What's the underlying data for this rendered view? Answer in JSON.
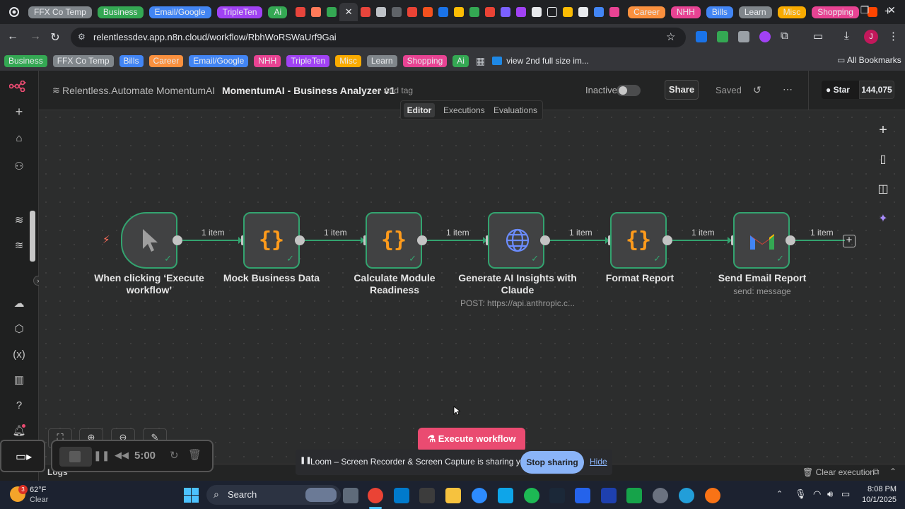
{
  "browser": {
    "tab_groups": [
      {
        "label": "FFX Co Temp",
        "color": "#80868b"
      },
      {
        "label": "Business",
        "color": "#34a853"
      },
      {
        "label": "Email/Google",
        "color": "#4285f4"
      },
      {
        "label": "TripleTen",
        "color": "#a142f4"
      },
      {
        "label": "Ai",
        "color": "#34a853"
      }
    ],
    "tab_groups_right": [
      {
        "label": "Career",
        "color": "#fa903e"
      },
      {
        "label": "NHH",
        "color": "#e84393"
      },
      {
        "label": "Bills",
        "color": "#4285f4"
      },
      {
        "label": "Learn",
        "color": "#80868b"
      },
      {
        "label": "Misc",
        "color": "#f9ab00"
      },
      {
        "label": "Shopping",
        "color": "#e84393"
      }
    ],
    "url": "relentlessdev.app.n8n.cloud/workflow/RbhWoRSWaUrf9Gai",
    "profile_initial": "J",
    "bookmarks": [
      {
        "label": "Business",
        "color": "#34a853"
      },
      {
        "label": "FFX Co Temp",
        "color": "#80868b"
      },
      {
        "label": "Bills",
        "color": "#4285f4"
      },
      {
        "label": "Career",
        "color": "#fa903e"
      },
      {
        "label": "Email/Google",
        "color": "#4285f4"
      },
      {
        "label": "NHH",
        "color": "#e84393"
      },
      {
        "label": "TripleTen",
        "color": "#a142f4"
      },
      {
        "label": "Misc",
        "color": "#f9ab00"
      },
      {
        "label": "Learn",
        "color": "#80868b"
      },
      {
        "label": "Shopping",
        "color": "#e84393"
      },
      {
        "label": "Ai",
        "color": "#34a853"
      }
    ],
    "bookmark_link": "view 2nd full size im...",
    "all_bookmarks": "All Bookmarks"
  },
  "n8n": {
    "breadcrumb": {
      "project": "Relentless.Automate",
      "folder": "MomentumAI",
      "workflow": "MomentumAI - Business Analyzer v1",
      "add_tag": "+ Add tag"
    },
    "status": {
      "label": "Inactive"
    },
    "share_label": "Share",
    "saved_label": "Saved",
    "github": {
      "star_label": "Star",
      "count": "144,075"
    },
    "tabs": [
      {
        "label": "Editor",
        "active": true
      },
      {
        "label": "Executions",
        "active": false
      },
      {
        "label": "Evaluations",
        "active": false
      }
    ],
    "nodes": [
      {
        "label": "When clicking ‘Execute workflow’",
        "subtitle": "",
        "icon": "cursor-icon"
      },
      {
        "label": "Mock Business Data",
        "subtitle": "",
        "icon": "code-icon"
      },
      {
        "label": "Calculate Module Readiness",
        "subtitle": "",
        "icon": "code-icon"
      },
      {
        "label": "Generate AI Insights with Claude",
        "subtitle": "POST: https://api.anthropic.c...",
        "icon": "globe-icon"
      },
      {
        "label": "Format Report",
        "subtitle": "",
        "icon": "code-icon"
      },
      {
        "label": "Send Email Report",
        "subtitle": "send: message",
        "icon": "gmail-icon"
      }
    ],
    "edge_label": "1 item",
    "execute_button": "Execute workflow",
    "logs_label": "Logs",
    "clear_execution": "Clear execution"
  },
  "loom": {
    "timer": "5:00",
    "sharing_message": "Loom – Screen Recorder & Screen Capture is sharing your screen.",
    "stop_label": "Stop sharing",
    "hide_label": "Hide"
  },
  "taskbar": {
    "weather_temp": "62°F",
    "weather_desc": "Clear",
    "weather_badge": "3",
    "search_label": "Search",
    "time": "8:08 PM",
    "date": "10/1/2025"
  }
}
